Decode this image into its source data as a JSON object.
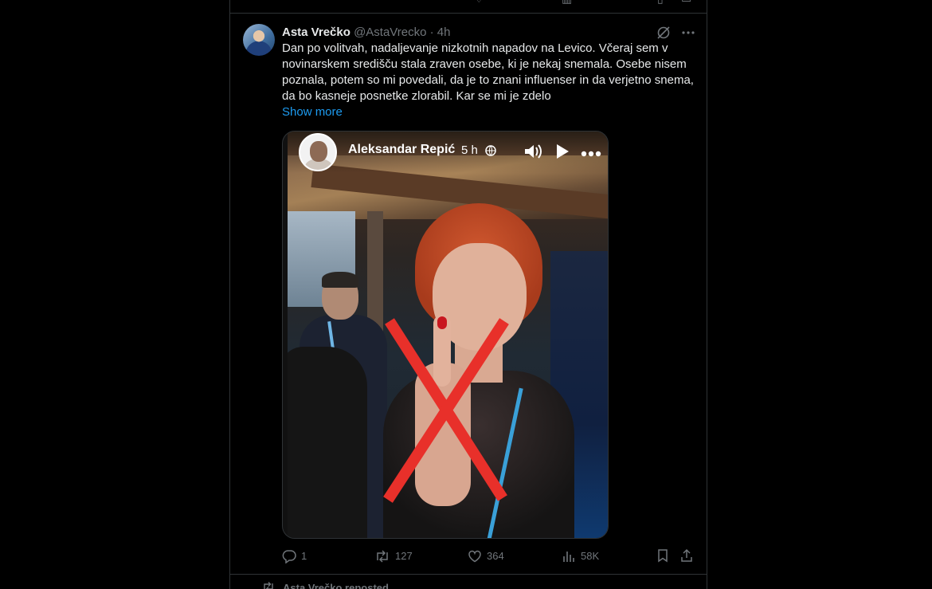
{
  "tweet": {
    "author_name": "Asta Vrečko",
    "author_handle": "@AstaVrecko",
    "separator": "·",
    "time": "4h",
    "text": "Dan po volitvah, nadaljevanje nizkotnih napadov na Levico. Včeraj sem v novinarskem središču stala zraven osebe, ki je nekaj snemala. Osebe nisem poznala, potem so mi povedali, da je to znani influenser in da verjetno snema, da bo kasneje posnetke zlorabil. Kar se mi je zdelo",
    "show_more": "Show more",
    "header_icons": [
      "grok-icon",
      "more-icon"
    ]
  },
  "video": {
    "author": "Aleksandar Repić",
    "time": "5 h",
    "icons": [
      "globe-icon",
      "volume-icon",
      "play-icon",
      "more-icon"
    ],
    "overlay_color": "#e8302a"
  },
  "actions": {
    "replies": "1",
    "reposts": "127",
    "likes": "364",
    "views": "58K"
  },
  "next": {
    "repost_label": "Asta Vrečko reposted"
  },
  "colors": {
    "background": "#000000",
    "text": "#e7e9ea",
    "muted": "#71767b",
    "link": "#1d9bf0",
    "border": "#2f3336"
  }
}
